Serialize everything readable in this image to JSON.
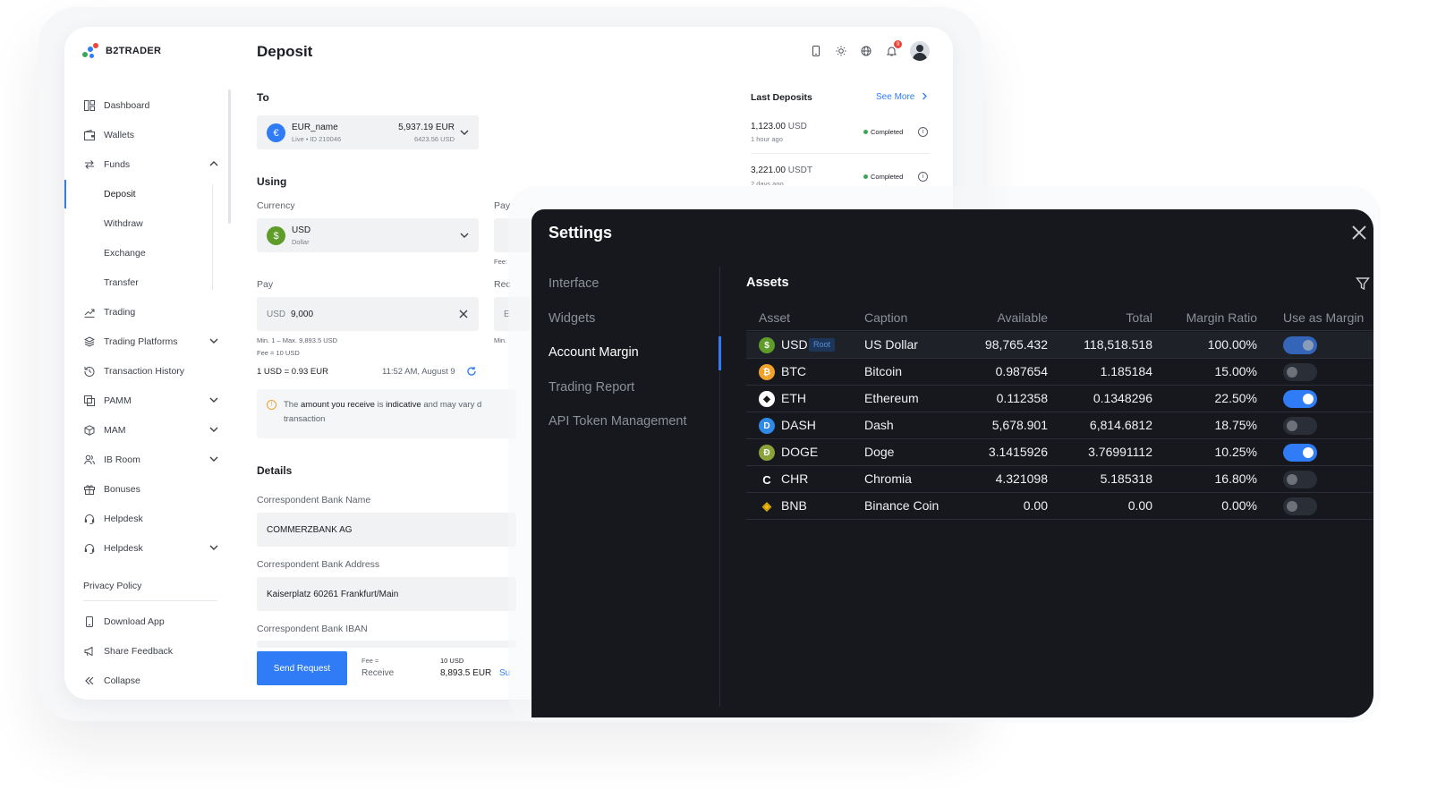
{
  "brand": {
    "name": "B2TRADER"
  },
  "page": {
    "title": "Deposit"
  },
  "notifications": {
    "count": "9"
  },
  "sidebar": {
    "items": [
      {
        "label": "Dashboard"
      },
      {
        "label": "Wallets"
      },
      {
        "label": "Funds"
      },
      {
        "label": "Trading"
      },
      {
        "label": "Trading Platforms"
      },
      {
        "label": "Transaction History"
      },
      {
        "label": "PAMM"
      },
      {
        "label": "MAM"
      },
      {
        "label": "IB Room"
      },
      {
        "label": "Bonuses"
      },
      {
        "label": "Helpdesk"
      },
      {
        "label": "Helpdesk"
      }
    ],
    "funds_sub": [
      "Deposit",
      "Withdraw",
      "Exchange",
      "Transfer"
    ],
    "privacy": "Privacy Policy",
    "download_app": "Download App",
    "share_feedback": "Share Feedback",
    "collapse": "Collapse"
  },
  "deposit": {
    "to_label": "To",
    "to_account": {
      "name": "EUR_name",
      "sub": "Live • ID 210046",
      "balance": "5,937.19 EUR",
      "balance_usd": "6423.56 USD"
    },
    "using_label": "Using",
    "currency_label": "Currency",
    "currency": {
      "code": "USD",
      "name": "Dollar"
    },
    "pay_label": "Pay",
    "pay_currency": "USD",
    "pay_value": "9,000",
    "limits": "Min. 1 – Max. 9,893.5 USD",
    "fee_line": "Fee = 10 USD",
    "rate": "1 USD = 0.93 EUR",
    "rate_time": "11:52 AM, August 9",
    "notice": {
      "part1": "The ",
      "bold1": "amount you receive",
      "part2": " is ",
      "bold2": "indicative",
      "part3": " and may vary d",
      "line2": "transaction"
    },
    "right_pay": "Pay",
    "right_fee": "Fee:",
    "right_receive": "Rec",
    "right_e": "E",
    "right_min": "Min.",
    "details_label": "Details",
    "bank_name_label": "Correspondent Bank Name",
    "bank_name": "COMMERZBANK AG",
    "bank_address_label": "Correspondent Bank Address",
    "bank_address": "Kaiserplatz 60261 Frankfurt/Main",
    "bank_iban_label": "Correspondent Bank IBAN",
    "send_button": "Send Request",
    "fee_small": "Fee ≈",
    "fee_value": "10 USD",
    "receive_label": "Receive",
    "receive_value": "8,893.5 EUR",
    "receive_suffix": "Su"
  },
  "last_deposits": {
    "title": "Last Deposits",
    "see_more": "See More",
    "items": [
      {
        "amount": "1,123.00",
        "currency": "USD",
        "time": "1 hour ago",
        "status": "Completed"
      },
      {
        "amount": "3,221.00",
        "currency": "USDT",
        "time": "2 days ago",
        "status": "Completed"
      }
    ]
  },
  "settings": {
    "title": "Settings",
    "menu": [
      "Interface",
      "Widgets",
      "Account Margin",
      "Trading Report",
      "API Token Management"
    ],
    "active_menu": "Account Margin",
    "assets_title": "Assets",
    "columns": [
      "Asset",
      "Caption",
      "Available",
      "Total",
      "Margin Ratio",
      "Use as Margin"
    ],
    "root_badge": "Root",
    "rows": [
      {
        "asset": "USD",
        "caption": "US Dollar",
        "available": "98,765.432",
        "total": "118,518.518",
        "margin_ratio": "100.00%",
        "use_as_margin": "locked-on",
        "icon": "dollar-coin-icon",
        "color": "#5f9c2a"
      },
      {
        "asset": "BTC",
        "caption": "Bitcoin",
        "available": "0.987654",
        "total": "1.185184",
        "margin_ratio": "15.00%",
        "use_as_margin": "off",
        "icon": "bitcoin-icon",
        "color": "#f2a12a"
      },
      {
        "asset": "ETH",
        "caption": "Ethereum",
        "available": "0.112358",
        "total": "0.1348296",
        "margin_ratio": "22.50%",
        "use_as_margin": "on",
        "icon": "ethereum-icon",
        "color": "#ffffff"
      },
      {
        "asset": "DASH",
        "caption": "Dash",
        "available": "5,678.901",
        "total": "6,814.6812",
        "margin_ratio": "18.75%",
        "use_as_margin": "off",
        "icon": "dash-icon",
        "color": "#2f8ae6"
      },
      {
        "asset": "DOGE",
        "caption": "Doge",
        "available": "3.1415926",
        "total": "3.76991112",
        "margin_ratio": "10.25%",
        "use_as_margin": "on",
        "icon": "doge-icon",
        "color": "#8aa23a"
      },
      {
        "asset": "CHR",
        "caption": "Chromia",
        "available": "4.321098",
        "total": "5.185318",
        "margin_ratio": "16.80%",
        "use_as_margin": "off",
        "icon": "chromia-icon",
        "color": "#ffffff"
      },
      {
        "asset": "BNB",
        "caption": "Binance Coin",
        "available": "0.00",
        "total": "0.00",
        "margin_ratio": "0.00%",
        "use_as_margin": "off",
        "icon": "binance-icon",
        "color": "#f0b90b"
      }
    ]
  },
  "colors": {
    "accent": "#2f7cf6",
    "modal_bg": "#16181d",
    "success": "#3aa757",
    "alert": "#f04438"
  }
}
